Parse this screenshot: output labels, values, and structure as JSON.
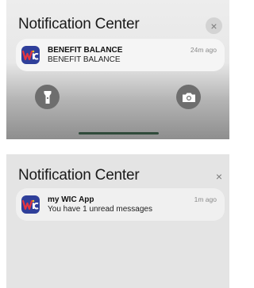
{
  "top_panel": {
    "title": "Notification Center",
    "close_symbol": "×",
    "notification": {
      "app_icon": "wic-app-icon",
      "title": "BENEFIT BALANCE",
      "body": "BENEFIT BALANCE",
      "time": "24m ago"
    },
    "controls": {
      "flashlight_icon": "flashlight-icon",
      "camera_icon": "camera-icon"
    }
  },
  "bottom_panel": {
    "title": "Notification Center",
    "close_symbol": "×",
    "notification": {
      "app_icon": "wic-app-icon",
      "title": "my WIC App",
      "body": "You have 1 unread messages",
      "time": "1m ago"
    }
  },
  "colors": {
    "app_icon_bg": "#2f3f9a",
    "accent_red": "#e8343f",
    "accent_yellow": "#f4c21b"
  }
}
